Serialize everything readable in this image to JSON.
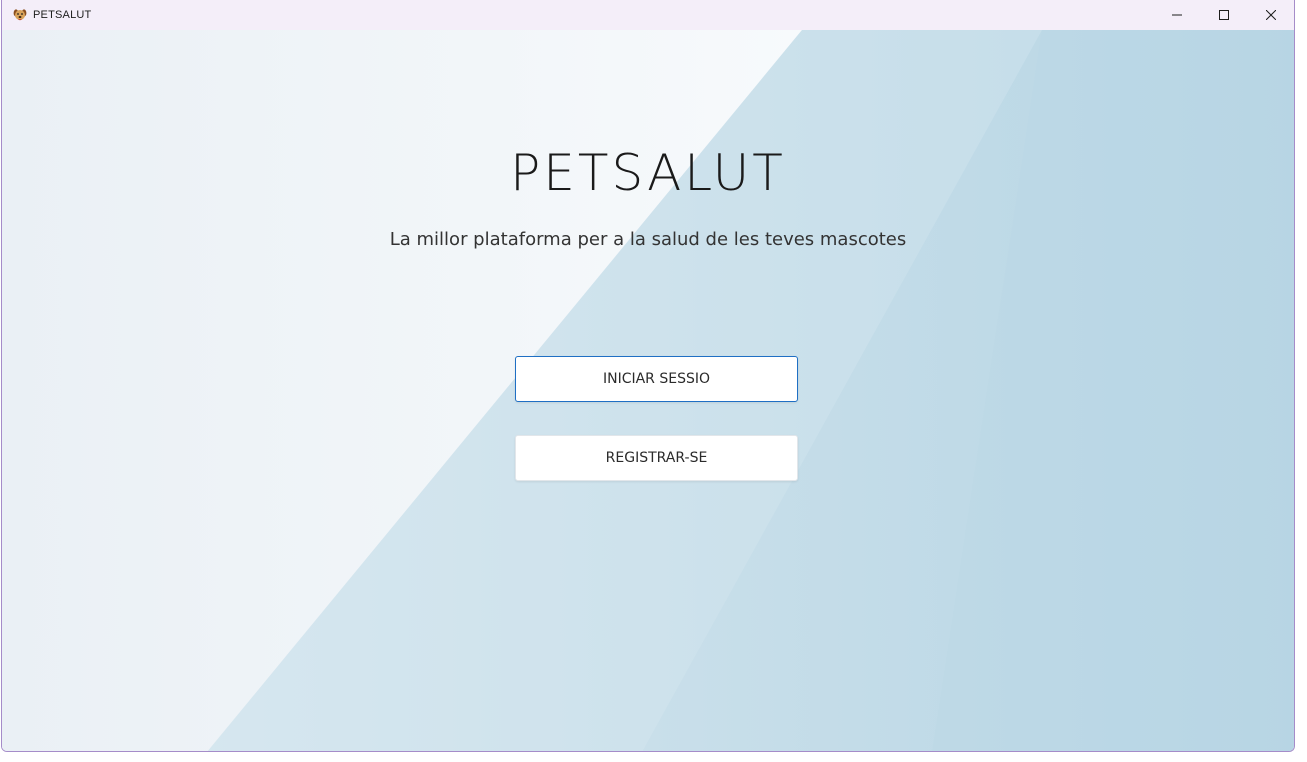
{
  "window": {
    "title": "PETSALUT",
    "app_icon": "dog-icon",
    "controls": {
      "minimize": "minimize-icon",
      "maximize": "maximize-icon",
      "close": "close-icon"
    }
  },
  "main": {
    "title": "PETSALUT",
    "subtitle": "La millor plataforma per a la salud de les teves mascotes",
    "login_button": "INICIAR SESSIO",
    "register_button": "REGISTRAR-SE"
  },
  "colors": {
    "accent": "#1f6fc4",
    "window_border": "#a58cc9",
    "titlebar_bg": "#f4eef9"
  }
}
